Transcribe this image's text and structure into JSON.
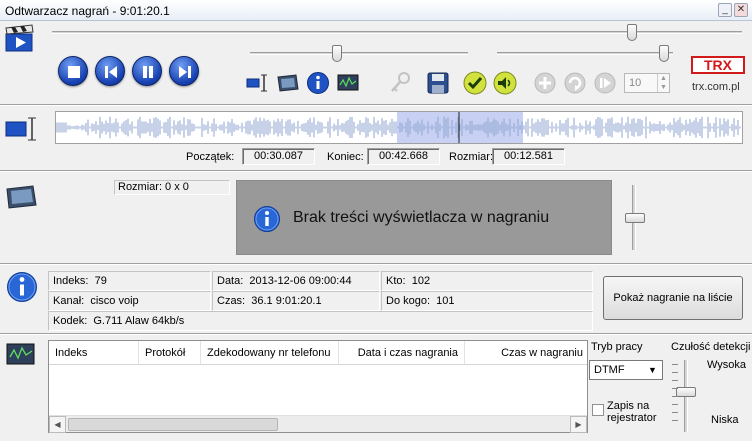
{
  "window": {
    "title": "Odtwarzacz nagrań - 9:01:20.1",
    "minimize_label": "_",
    "close_label": "✕"
  },
  "toolbar": {
    "position_fraction": 0.84,
    "volume_fraction": 0.4,
    "balance_fraction": 0.95,
    "repeat_count": "10",
    "logo_text": "TRX",
    "website": "trx.com.pl"
  },
  "selection": {
    "start_label": "Początek:",
    "start_value": "00:30.087",
    "end_label": "Koniec:",
    "end_value": "00:42.668",
    "size_label": "Rozmiar:",
    "size_value": "00:12.581"
  },
  "display": {
    "size_text": "Rozmiar: 0 x 0",
    "message": "Brak treści wyświetlacza w nagraniu",
    "slider_fraction": 0.5
  },
  "info": {
    "index_label": "Indeks:",
    "index_value": "79",
    "date_label": "Data:",
    "date_value": "2013-12-06 09:00:44",
    "from_label": "Kto:",
    "from_value": "102",
    "channel_label": "Kanał:",
    "channel_value": "cisco voip",
    "time_label": "Czas:",
    "time_value": "36.1  9:01:20.1",
    "to_label": "Do kogo:",
    "to_value": "101",
    "codec_label": "Kodek:",
    "codec_value": "G.711 Alaw 64kb/s",
    "show_button": "Pokaż nagranie na liście"
  },
  "dtmf": {
    "columns": [
      "Indeks",
      "Protokół",
      "Zdekodowany nr telefonu",
      "Data i czas nagrania",
      "Czas w nagraniu"
    ],
    "mode_label": "Tryb pracy",
    "mode_value": "DTMF",
    "record_label": "Zapis na rejestrator",
    "sensitivity_label": "Czułość detekcji",
    "high_label": "Wysoka",
    "low_label": "Niska"
  }
}
